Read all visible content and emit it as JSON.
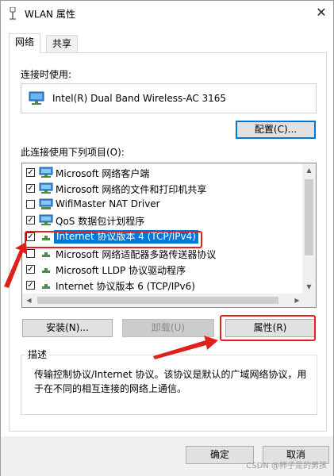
{
  "window": {
    "title": "WLAN 属性",
    "close_symbol": "✕"
  },
  "tabs": [
    {
      "label": "网络"
    },
    {
      "label": "共享"
    }
  ],
  "connect_using": {
    "label": "连接时使用:",
    "adapter_name": "Intel(R) Dual Band Wireless-AC 3165"
  },
  "configure_button": "配置(C)...",
  "items_label": "此连接使用下列项目(O):",
  "items": [
    {
      "label": "Microsoft 网络客户端",
      "checked": true
    },
    {
      "label": "Microsoft 网络的文件和打印机共享",
      "checked": true
    },
    {
      "label": "WifiMaster NAT Driver",
      "checked": false
    },
    {
      "label": "QoS 数据包计划程序",
      "checked": true
    },
    {
      "label": "Internet 协议版本 4 (TCP/IPv4)",
      "checked": true,
      "selected": true
    },
    {
      "label": "Microsoft 网络适配器多路传送器协议",
      "checked": false
    },
    {
      "label": "Microsoft LLDP 协议驱动程序",
      "checked": true
    },
    {
      "label": "Internet 协议版本 6 (TCP/IPv6)",
      "checked": true
    }
  ],
  "buttons": {
    "install": "安装(N)...",
    "uninstall": "卸载(U)",
    "properties": "属性(R)",
    "ok": "确定",
    "cancel": "取消"
  },
  "description": {
    "title": "描述",
    "text": "传输控制协议/Internet 协议。该协议是默认的广域网络协议，用于在不同的相互连接的网络上通信。"
  },
  "watermark": "CSDN @柿子是的男孩",
  "colors": {
    "accent": "#0078d7",
    "annotation_red": "#e0211b"
  },
  "icons": {
    "title": "wifi-antenna-icon",
    "adapter": "network-adapter-icon",
    "client": "network-client-icon",
    "protocol": "network-protocol-icon"
  }
}
